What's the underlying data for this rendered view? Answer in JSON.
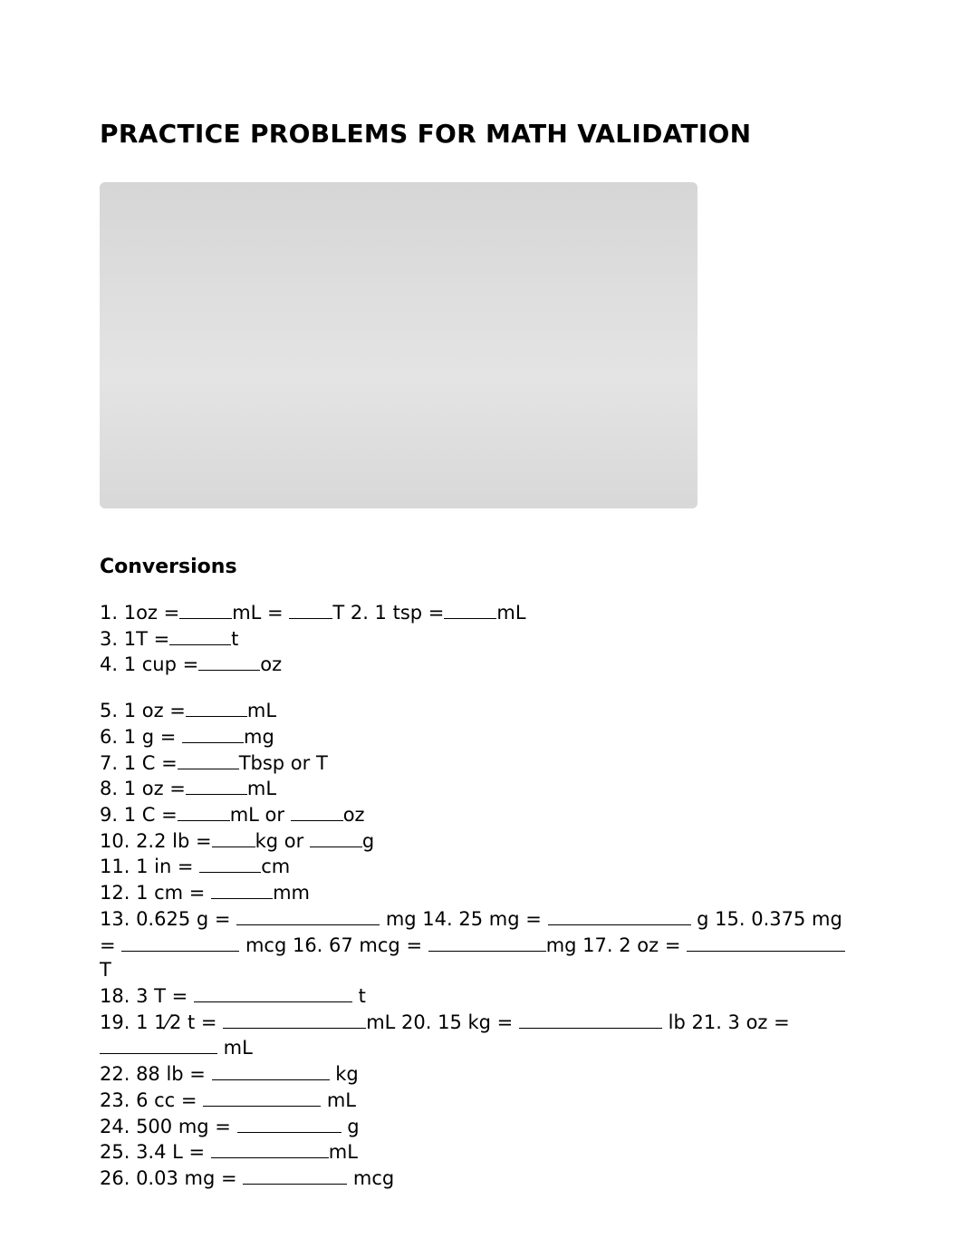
{
  "title": "PRACTICE PROBLEMS FOR MATH VALIDATION",
  "subheading": "Conversions",
  "p1": {
    "q1a": "1. 1oz =",
    "q1b": "mL = ",
    "q1c": "T 2. 1 tsp =",
    "q1d": "mL",
    "q3a": "3. 1T =",
    "q3b": "t",
    "q4a": "4. 1 cup =",
    "q4b": "oz"
  },
  "p2": {
    "q5a": "5. 1 oz =",
    "q5b": "mL",
    "q6a": "6. 1 g = ",
    "q6b": "mg",
    "q7a": "7. 1 C =",
    "q7b": "Tbsp or T",
    "q8a": "8. 1 oz =",
    "q8b": "mL",
    "q9a": "9. 1 C =",
    "q9b": "mL or ",
    "q9c": "oz",
    "q10a": "10. 2.2 lb =",
    "q10b": "kg or ",
    "q10c": "g",
    "q11a": "11. 1 in = ",
    "q11b": "cm",
    "q12a": "12. 1 cm = ",
    "q12b": "mm",
    "q13a": "13. 0.625 g = ",
    "q13b": " mg 14. 25 mg = ",
    "q13c": " g 15. 0.375 mg = ",
    "q13d": " mcg 16. 67 mcg = ",
    "q13e": "mg 17. 2 oz = ",
    "q13f": "T",
    "q18a": "18. 3 T = ",
    "q18b": " t",
    "q19a": "19. 1 1⁄2 t = ",
    "q19b": "mL 20. 15 kg = ",
    "q19c": " lb 21. 3 oz = ",
    "q19d": " mL",
    "q22a": "22. 88 lb = ",
    "q22b": " kg",
    "q23a": "23. 6 cc = ",
    "q23b": " mL",
    "q24a": "24. 500 mg = ",
    "q24b": " g",
    "q25a": "25. 3.4 L = ",
    "q25b": "mL",
    "q26a": "26. 0.03 mg = ",
    "q26b": " mcg"
  }
}
